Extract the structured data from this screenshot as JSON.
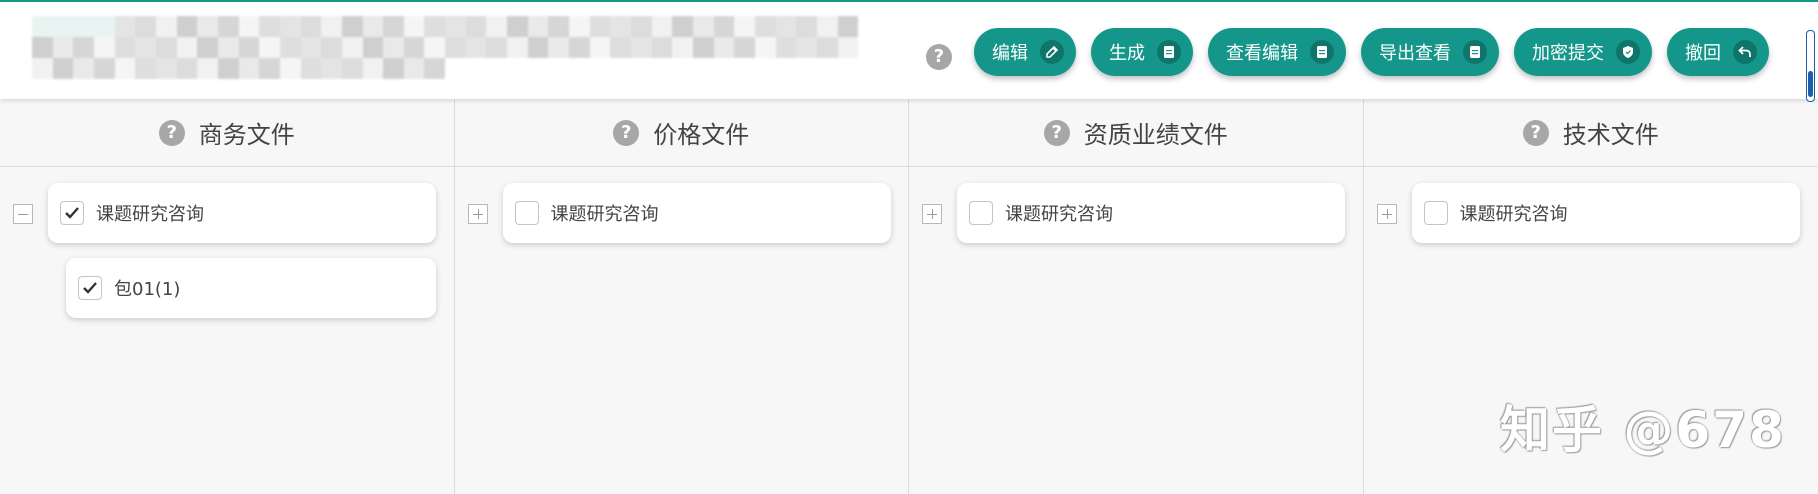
{
  "header": {
    "help_icon": "question-circle-icon",
    "toolbar": [
      {
        "label": "编辑",
        "icon": "edit-icon"
      },
      {
        "label": "生成",
        "icon": "document-icon"
      },
      {
        "label": "查看编辑",
        "icon": "document-icon"
      },
      {
        "label": "导出查看",
        "icon": "document-icon"
      },
      {
        "label": "加密提交",
        "icon": "shield-icon"
      },
      {
        "label": "撤回",
        "icon": "undo-icon"
      }
    ]
  },
  "columns": [
    {
      "title": "商务文件",
      "expanded": true,
      "root": {
        "label": "课题研究咨询",
        "checked": true
      },
      "children": [
        {
          "label": "包01(1)",
          "checked": true
        }
      ]
    },
    {
      "title": "价格文件",
      "expanded": false,
      "root": {
        "label": "课题研究咨询",
        "checked": false
      },
      "children": []
    },
    {
      "title": "资质业绩文件",
      "expanded": false,
      "root": {
        "label": "课题研究咨询",
        "checked": false
      },
      "children": []
    },
    {
      "title": "技术文件",
      "expanded": false,
      "root": {
        "label": "课题研究咨询",
        "checked": false
      },
      "children": []
    }
  ],
  "watermark": "知乎 @678",
  "colors": {
    "accent": "#14978a",
    "panel": "#f7f7f7",
    "help": "#a7a7a7",
    "scrollbar": "#1a5fa8"
  }
}
